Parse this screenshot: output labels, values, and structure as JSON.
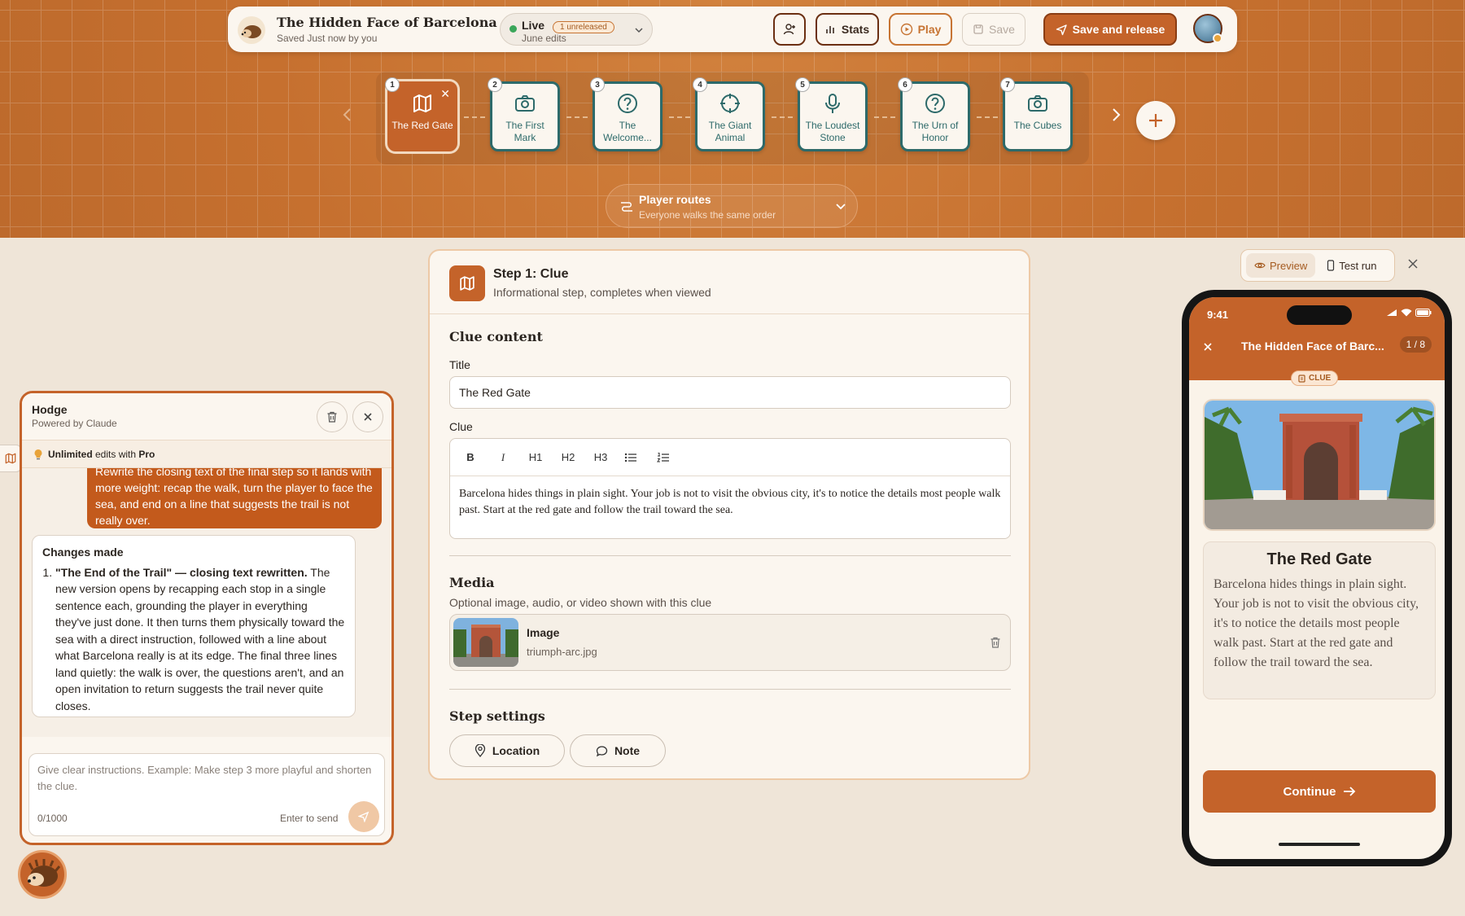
{
  "app": {
    "title": "The Hidden Face of Barcelona",
    "saved_status": "Saved Just now by you",
    "live": {
      "label": "Live",
      "badge": "1 unreleased",
      "sub": "June edits"
    },
    "buttons": {
      "stats": "Stats",
      "play": "Play",
      "save": "Save",
      "release": "Save and release"
    }
  },
  "steps": [
    {
      "num": "1",
      "label": "The Red Gate",
      "icon": "map-icon",
      "active": true
    },
    {
      "num": "2",
      "label": "The First Mark",
      "icon": "camera-icon"
    },
    {
      "num": "3",
      "label": "The Welcome...",
      "icon": "question-icon"
    },
    {
      "num": "4",
      "label": "The Giant Animal",
      "icon": "crosshair-icon"
    },
    {
      "num": "5",
      "label": "The Loudest Stone",
      "icon": "mic-icon"
    },
    {
      "num": "6",
      "label": "The Urn of Honor",
      "icon": "question-icon"
    },
    {
      "num": "7",
      "label": "The Cubes",
      "icon": "camera-icon"
    }
  ],
  "routes": {
    "title": "Player routes",
    "sub": "Everyone walks the same order"
  },
  "editor": {
    "step_title": "Step 1: Clue",
    "step_sub": "Informational step, completes when viewed",
    "clue_content": "Clue content",
    "title_label": "Title",
    "title_value": "The Red Gate",
    "clue_label": "Clue",
    "toolbar": [
      "B",
      "I",
      "H1",
      "H2",
      "H3"
    ],
    "clue_text": "Barcelona hides things in plain sight. Your job is not to visit the obvious city, it's to notice the details most people walk past. Start at the red gate and follow the trail toward the sea.",
    "media_title": "Media",
    "media_sub": "Optional image, audio, or video shown with this clue",
    "media_name": "Image",
    "media_file": "triumph-arc.jpg",
    "settings_title": "Step settings",
    "location": "Location",
    "note": "Note"
  },
  "chat": {
    "name": "Hodge",
    "powered": "Powered by Claude",
    "promo_prefix": "Unlimited",
    "promo_mid": " edits with ",
    "promo_pro": "Pro",
    "user_msg": "Rewrite the closing text of the final step so it lands with more weight: recap the walk, turn the player to face the sea, and end on a line that suggests the trail is not really over.",
    "changes_head": "Changes made",
    "change_1": "\"The End of the Trail\" — closing text rewritten.",
    "change_1_rest": " The new version opens by recapping each stop in a single sentence each, grounding the player in everything they've just done. It then turns them physically toward the sea with a direct instruction, followed with a line about what Barcelona really is at its edge. The final three lines land quietly: the walk is over, the questions aren't, and an open invitation to return suggests the trail never quite closes.",
    "placeholder": "Give clear instructions. Example: Make step 3 more playful and shorten the clue.",
    "count": "0/1000",
    "enter_hint": "Enter to send"
  },
  "preview": {
    "tab_preview": "Preview",
    "tab_test": "Test run",
    "time": "9:41",
    "title": "The Hidden Face of Barc...",
    "page": "1 / 8",
    "badge": "CLUE",
    "heading": "The Red Gate",
    "text": "Barcelona hides things in plain sight. Your job is not to visit the obvious city, it's to notice the details most people walk past. Start at the red gate and follow the trail toward the sea.",
    "continue": "Continue"
  },
  "colors": {
    "accent": "#c4632a",
    "teal": "#2d6a6a",
    "cream": "#fbf6ef",
    "live": "#3aa65a"
  }
}
